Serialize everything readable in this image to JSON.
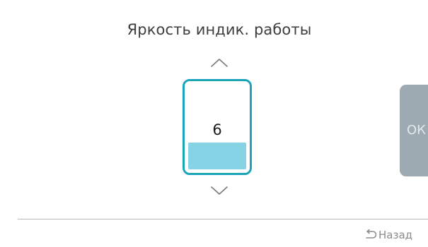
{
  "screen": {
    "title": "Яркость индик. работы"
  },
  "level": {
    "value": "6",
    "fill_fraction": 0.32
  },
  "actions": {
    "ok_label": "ОК",
    "back_label": "Назад"
  },
  "icons": {
    "increase": "chevron-up-icon",
    "decrease": "chevron-down-icon",
    "back": "back-arrow-icon"
  },
  "colors": {
    "accent": "#1aa6b8",
    "level_fill": "#86d3e6",
    "ok_button": "#9eaab1",
    "divider": "#b9b9b9"
  }
}
